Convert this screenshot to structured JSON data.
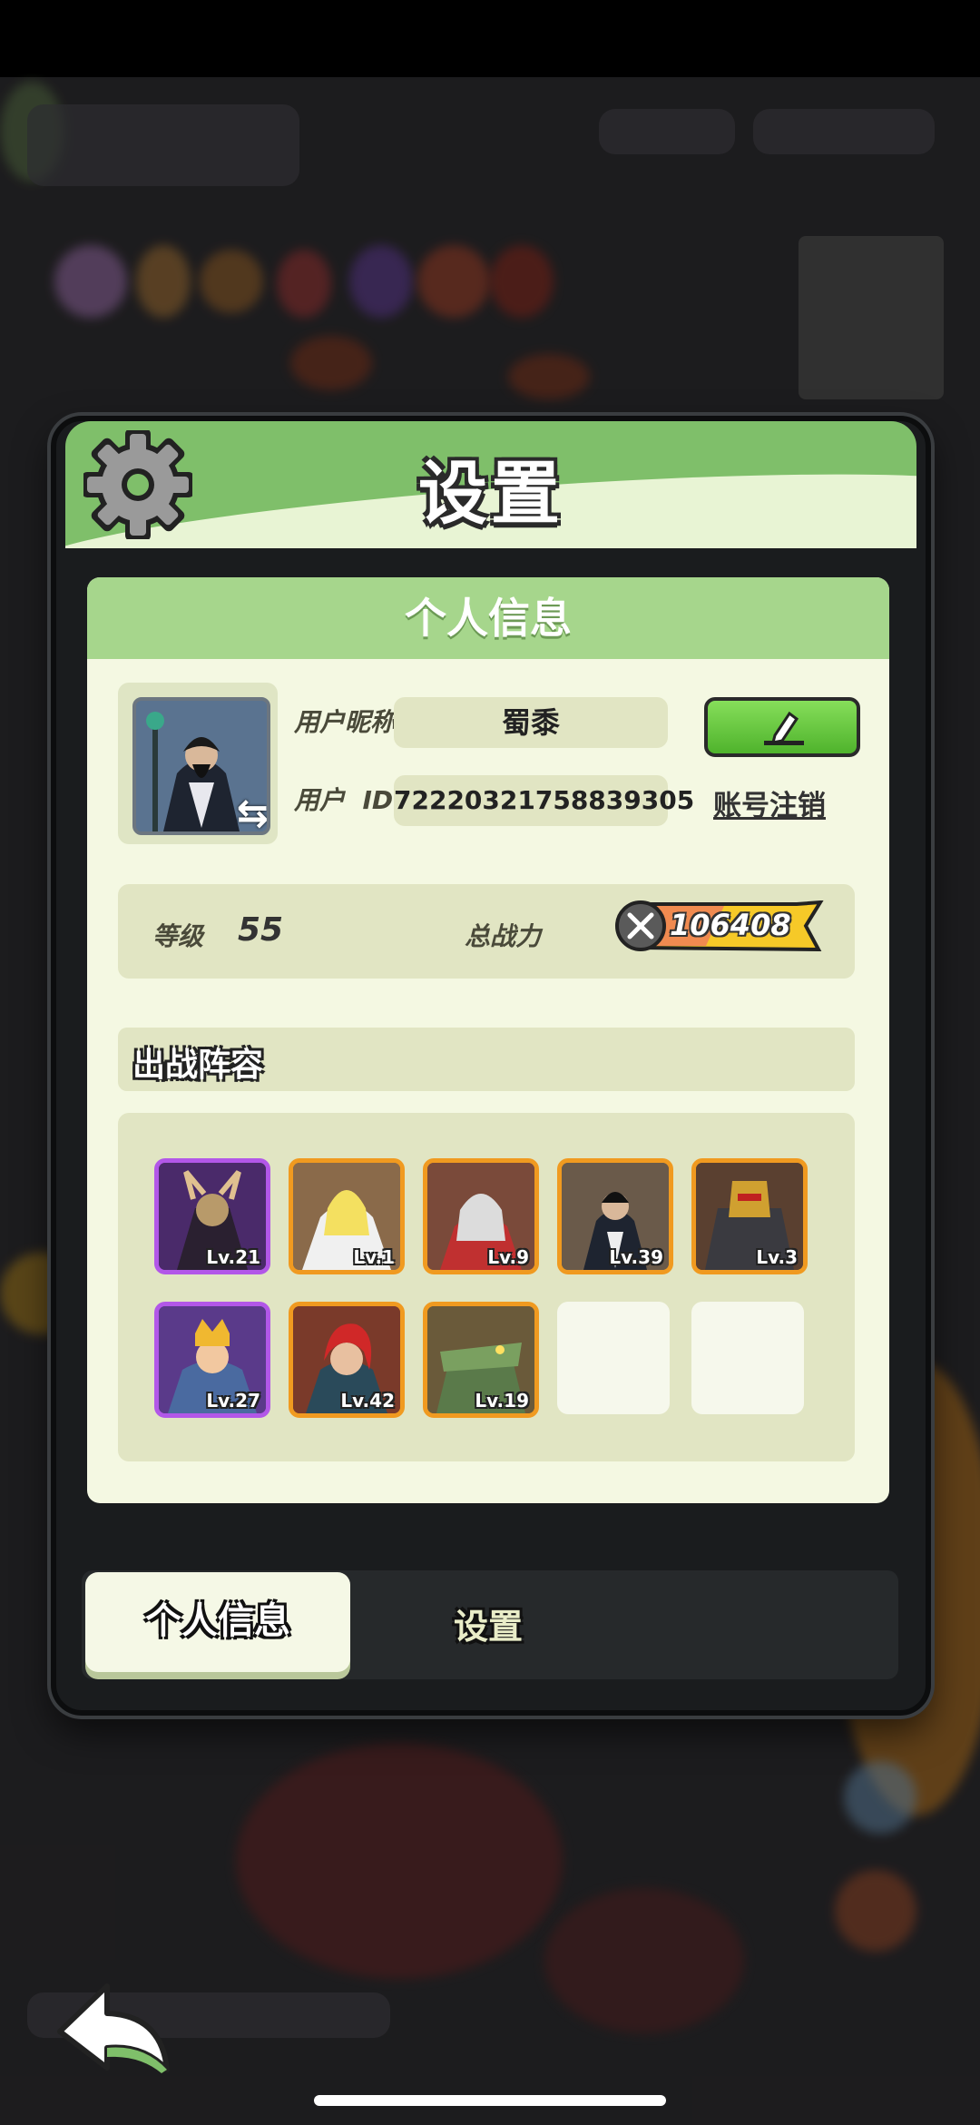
{
  "dialog": {
    "title": "设置"
  },
  "profile": {
    "section_title": "个人信息",
    "nickname_label": "用户昵称",
    "nickname": "蜀黍",
    "id_label": "用户  ID",
    "user_id": "72220321758839305",
    "cancel_account_label": "账号注销",
    "level_label": "等级",
    "level": "55",
    "power_label": "总战力",
    "power": "106408"
  },
  "team": {
    "title": "出战阵容",
    "heroes": [
      {
        "level": "Lv.21",
        "rarity": "purple"
      },
      {
        "level": "Lv.1",
        "rarity": "orange"
      },
      {
        "level": "Lv.9",
        "rarity": "orange"
      },
      {
        "level": "Lv.39",
        "rarity": "orange"
      },
      {
        "level": "Lv.3",
        "rarity": "orange"
      },
      {
        "level": "Lv.27",
        "rarity": "purple"
      },
      {
        "level": "Lv.42",
        "rarity": "orange"
      },
      {
        "level": "Lv.19",
        "rarity": "orange"
      }
    ],
    "empty_slots": 2
  },
  "tabs": {
    "active": "个人信息",
    "inactive": "设置"
  },
  "icons": {
    "gear": "gear-icon",
    "edit": "pencil-icon",
    "swap": "swap-icon",
    "back": "back-arrow-icon",
    "power": "swords-icon"
  },
  "colors": {
    "accent_green": "#7fbf6a",
    "edit_button": "#5fc23a",
    "purple_rarity": "#b257e8",
    "orange_rarity": "#f09a20",
    "power_badge": "#f6c928"
  }
}
